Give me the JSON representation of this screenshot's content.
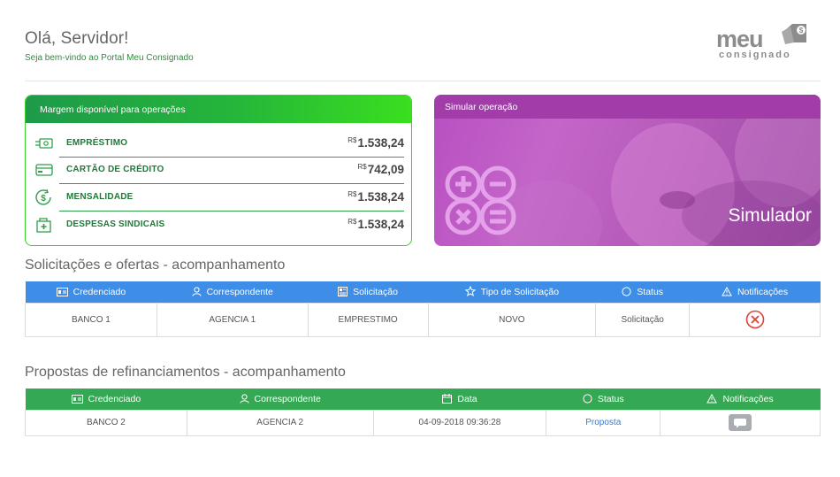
{
  "header": {
    "greeting": "Olá, Servidor!",
    "subtitle": "Seja bem-vindo ao Portal Meu Consignado",
    "logo_word": "meu",
    "logo_sub": "consignado"
  },
  "margin_card": {
    "title": "Margem disponível para operações",
    "currency": "R$",
    "rows": [
      {
        "icon": "money-icon",
        "label": "EMPRÉSTIMO",
        "value": "1.538,24"
      },
      {
        "icon": "credit-card-icon",
        "label": "CARTÃO DE CRÉDITO",
        "value": "742,09"
      },
      {
        "icon": "dollar-cycle-icon",
        "label": "MENSALIDADE",
        "value": "1.538,24"
      },
      {
        "icon": "union-docs-icon",
        "label": "DESPESAS SINDICAIS",
        "value": "1.538,24"
      }
    ]
  },
  "sim_card": {
    "head": "Simular operação",
    "title": "Simulador"
  },
  "requests": {
    "title": "Solicitações e ofertas - acompanhamento",
    "headers": [
      "Credenciado",
      "Correspondente",
      "Solicitação",
      "Tipo de Solicitação",
      "Status",
      "Notificações"
    ],
    "rows": [
      {
        "credenciado": "BANCO 1",
        "correspondente": "AGENCIA 1",
        "solicitacao": "EMPRESTIMO",
        "tipo": "NOVO",
        "status": "Solicitação"
      }
    ]
  },
  "proposals": {
    "title": "Propostas de refinanciamentos - acompanhamento",
    "headers": [
      "Credenciado",
      "Correspondente",
      "Data",
      "Status",
      "Notificações"
    ],
    "rows": [
      {
        "credenciado": "BANCO 2",
        "correspondente": "AGENCIA 2",
        "data": "04-09-2018 09:36:28",
        "status": "Proposta"
      }
    ]
  },
  "colors": {
    "green": "#34a853",
    "blue_header": "#3e8ee8",
    "purple": "#a13ca9",
    "red_icon": "#e0403a"
  }
}
